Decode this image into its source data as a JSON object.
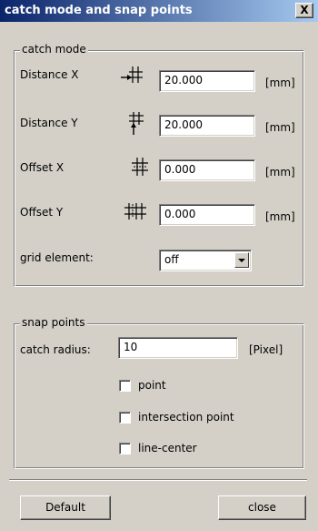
{
  "window": {
    "title": "catch mode and snap points",
    "close_glyph": "X"
  },
  "catch_mode": {
    "legend": "catch mode",
    "rows": [
      {
        "label": "Distance X",
        "icon": "distance-x-icon",
        "value": "20.000",
        "unit": "[mm]"
      },
      {
        "label": "Distance Y",
        "icon": "distance-y-icon",
        "value": "20.000",
        "unit": "[mm]"
      },
      {
        "label": "Offset X",
        "icon": "offset-x-icon",
        "value": "0.000",
        "unit": "[mm]"
      },
      {
        "label": "Offset Y",
        "icon": "offset-y-icon",
        "value": "0.000",
        "unit": "[mm]"
      }
    ],
    "grid_element": {
      "label": "grid element:",
      "value": "off"
    }
  },
  "snap_points": {
    "legend": "snap points",
    "catch_radius": {
      "label": "catch radius:",
      "value": "10",
      "unit": "[Pixel]"
    },
    "options": [
      {
        "label": "point",
        "checked": false
      },
      {
        "label": "intersection point",
        "checked": false
      },
      {
        "label": "line-center",
        "checked": false
      }
    ]
  },
  "buttons": {
    "default": "Default",
    "close": "close"
  }
}
